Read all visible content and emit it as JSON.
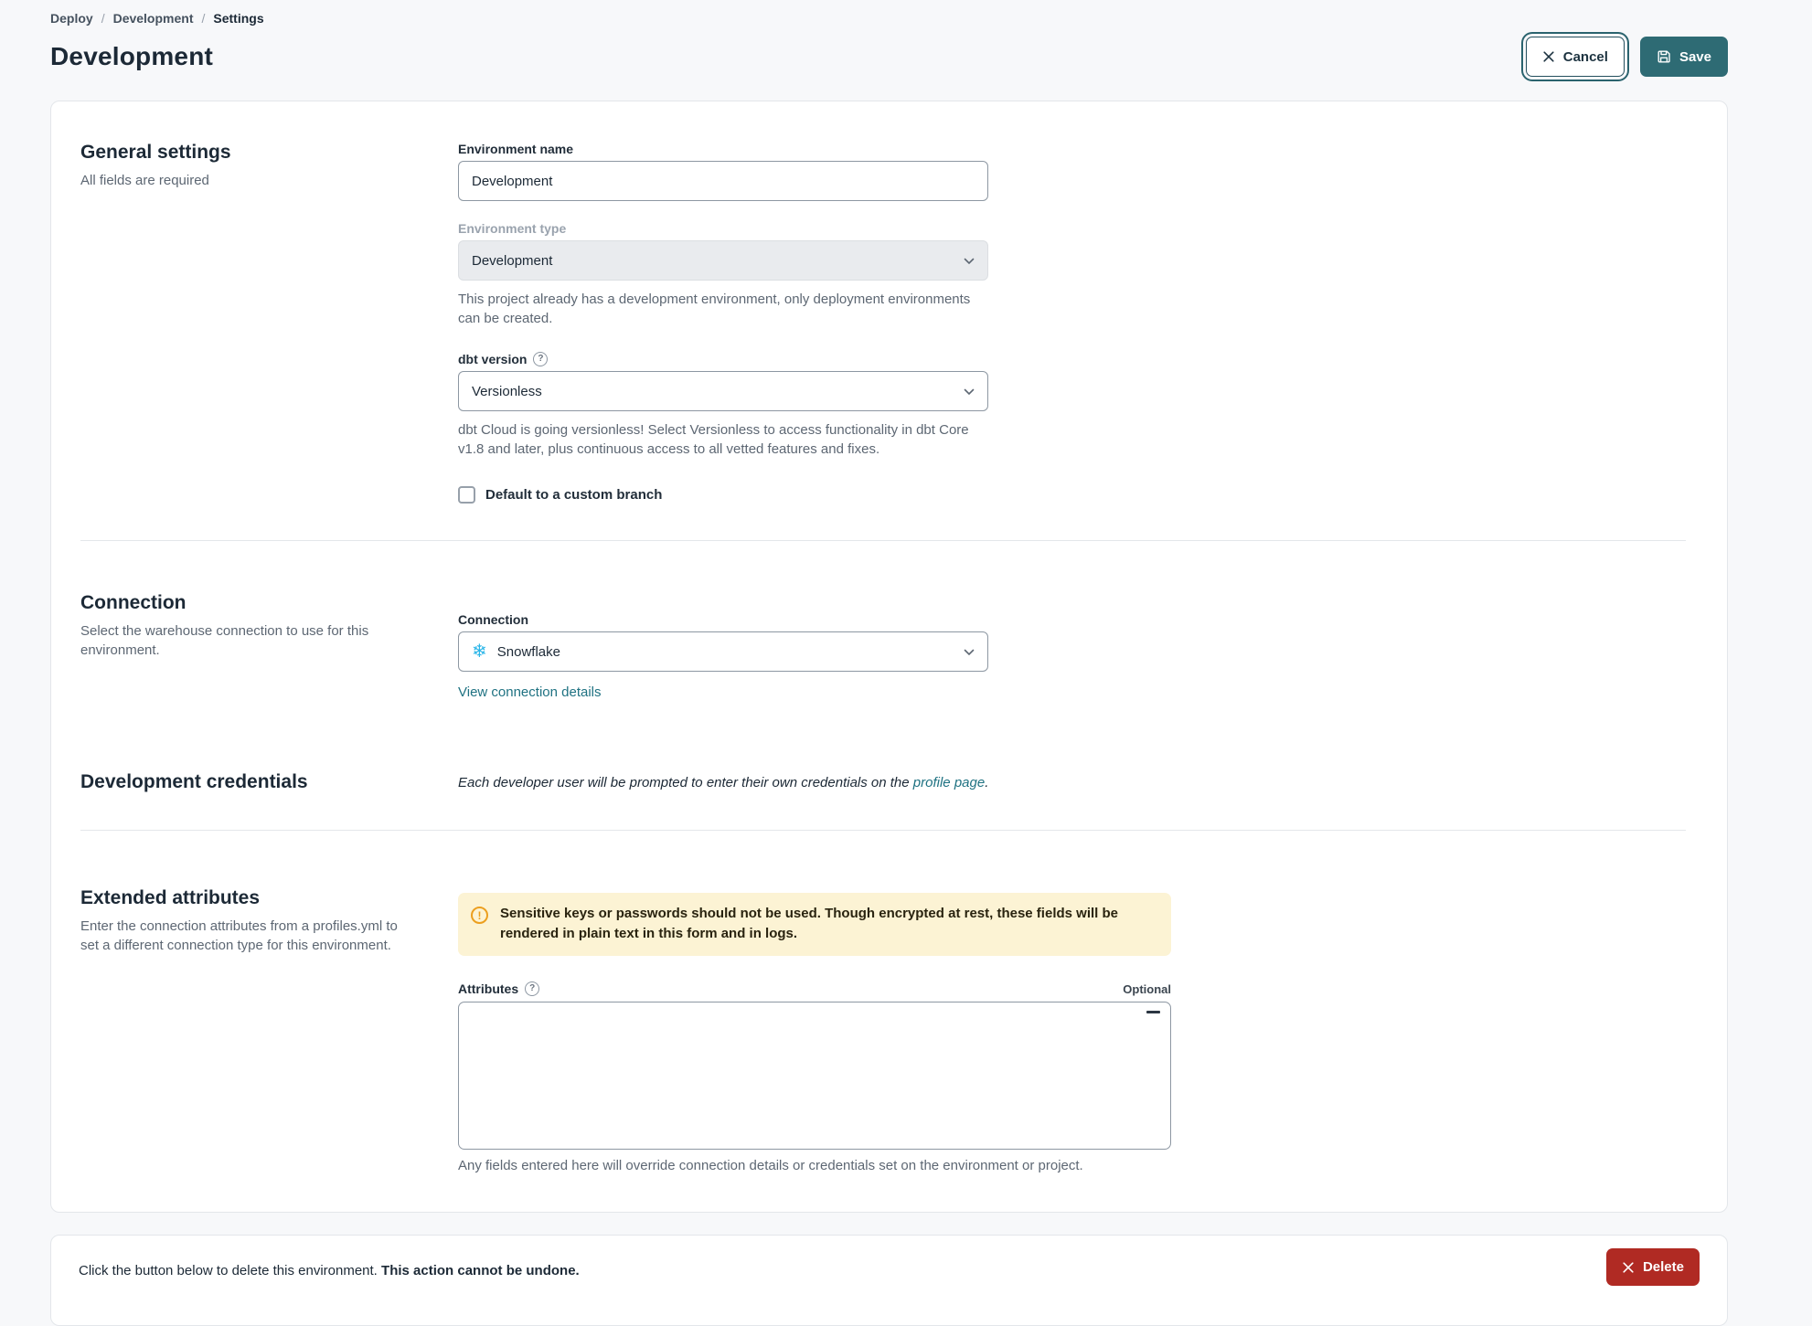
{
  "breadcrumb": {
    "items": [
      "Deploy",
      "Development"
    ],
    "separator": "/",
    "current": "Settings"
  },
  "header": {
    "title": "Development",
    "cancel_label": "Cancel",
    "save_label": "Save"
  },
  "general": {
    "heading": "General settings",
    "subheading": "All fields are required",
    "env_name": {
      "label": "Environment name",
      "value": "Development"
    },
    "env_type": {
      "label": "Environment type",
      "value": "Development",
      "help": "This project already has a development environment, only deployment environments can be created."
    },
    "dbt_version": {
      "label": "dbt version",
      "help_icon": "?",
      "value": "Versionless",
      "help": "dbt Cloud is going versionless! Select Versionless to access functionality in dbt Core v1.8 and later, plus continuous access to all vetted features and fixes."
    },
    "custom_branch": {
      "label": "Default to a custom branch",
      "checked": false
    }
  },
  "connection": {
    "heading": "Connection",
    "subheading": "Select the warehouse connection to use for this environment.",
    "field_label": "Connection",
    "value": "Snowflake",
    "snowflake_icon": "❄",
    "link": "View connection details"
  },
  "credentials": {
    "heading": "Development credentials",
    "note_prefix": "Each developer user will be prompted to enter their own credentials on the ",
    "note_link": "profile page",
    "note_suffix": "."
  },
  "extended": {
    "heading": "Extended attributes",
    "subheading": "Enter the connection attributes from a profiles.yml to set a different connection type for this environment.",
    "warning_icon": "!",
    "warning": "Sensitive keys or passwords should not be used. Though encrypted at rest, these fields will be rendered in plain text in this form and in logs.",
    "attributes_label": "Attributes",
    "help_icon": "?",
    "optional_label": "Optional",
    "attributes_value": "",
    "note": "Any fields entered here will override connection details or credentials set on the environment or project."
  },
  "danger": {
    "text": "Click the button below to delete this environment. ",
    "text_bold": "This action cannot be undone.",
    "delete_label": "Delete"
  },
  "colors": {
    "accent_teal": "#2e6b74",
    "link_teal": "#1f7282",
    "danger_red": "#b02a23",
    "warning_bg": "#fcf3d4",
    "snowflake_blue": "#29b5e8",
    "page_bg": "#f7f8fa"
  }
}
